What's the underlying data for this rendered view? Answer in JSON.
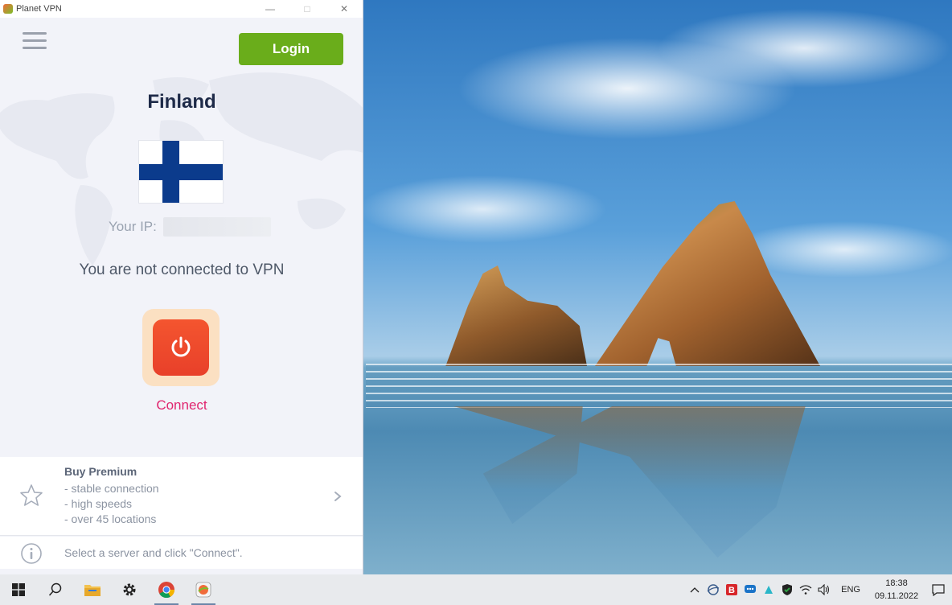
{
  "window": {
    "title": "Planet VPN",
    "minimize": "—",
    "maximize": "□",
    "close": "✕"
  },
  "header": {
    "login_label": "Login"
  },
  "location": {
    "country": "Finland",
    "ip_label": "Your IP:"
  },
  "status": {
    "message": "You are not connected to VPN",
    "connect_label": "Connect"
  },
  "premium": {
    "title": "Buy Premium",
    "features": [
      "- stable connection",
      "- high speeds",
      "- over 45 locations"
    ]
  },
  "hint": {
    "text": "Select a server and click \"Connect\"."
  },
  "taskbar": {
    "lang": "ENG",
    "time": "18:38",
    "date": "09.11.2022"
  },
  "colors": {
    "login": "#6aad1b",
    "connect": "#e0256f",
    "power": "#f4552f",
    "flag_blue": "#0b3b8c"
  }
}
